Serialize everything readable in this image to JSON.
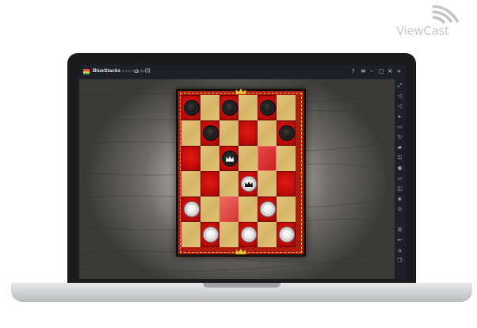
{
  "watermark": {
    "text": "ViewCast"
  },
  "bluestacks": {
    "title": "BlueStacks",
    "version": "5.0.0.7228 (beta)",
    "home_icon": "home-icon",
    "multi_instance_icon": "multi-instance-icon",
    "help_icon": "help-icon",
    "menu_icon": "menu-icon",
    "minimize_icon": "minimize-icon",
    "maximize_icon": "maximize-icon",
    "close_icon": "close-icon",
    "collapse_icon": "collapse-sidebar-icon"
  },
  "sidebar_icons": [
    "fullscreen-icon",
    "volume-up-icon",
    "volume-down-icon",
    "play-video-icon",
    "keyboard-icon",
    "rotate-icon",
    "shake-icon",
    "screenshot-icon",
    "folder-icon",
    "apk-icon",
    "multi-instance-sync-icon",
    "macro-icon",
    "eco-mode-icon",
    "settings-icon",
    "back-icon",
    "home-icon",
    "recent-apps-icon"
  ],
  "game": {
    "name": "checkers",
    "colors": {
      "dark_square": "#c40d0a",
      "light_square": "#d6b466",
      "frame": "#b01b10"
    },
    "board": [
      [
        "dB",
        "l",
        "dB",
        "l",
        "dB",
        "l"
      ],
      [
        "l",
        "dB",
        "l",
        "d",
        "l",
        "dB"
      ],
      [
        "d",
        "l",
        "dBK",
        "l",
        "hi",
        "l"
      ],
      [
        "l",
        "d",
        "l",
        "dWK",
        "l",
        "d"
      ],
      [
        "dW",
        "l",
        "hi2",
        "l",
        "dW",
        "l"
      ],
      [
        "l",
        "dW",
        "l",
        "dW",
        "l",
        "dW"
      ]
    ]
  }
}
